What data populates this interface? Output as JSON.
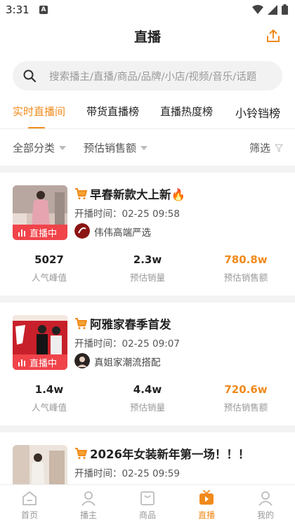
{
  "status_bar": {
    "time": "3:31",
    "notification_icon": "A"
  },
  "header": {
    "title": "直播",
    "share_icon": "share-icon"
  },
  "search": {
    "placeholder": "搜索播主/直播/商品/品牌/小店/视频/音乐/话题"
  },
  "tabs": [
    {
      "label": "实时直播间",
      "active": true
    },
    {
      "label": "带货直播榜",
      "active": false
    },
    {
      "label": "直播热度榜",
      "active": false
    },
    {
      "label": "小铃铛榜",
      "active": false
    }
  ],
  "filters": {
    "category": "全部分类",
    "sort": "预估销售额",
    "filter": "筛选"
  },
  "colors": {
    "accent": "#f08a1c",
    "live_badge": "#f0434a"
  },
  "streams": [
    {
      "title": "早春新款大上新🔥",
      "start_time": "开播时间：02-25 09:58",
      "anchor": "伟伟高端严选",
      "live_label": "直播中",
      "stats": [
        {
          "value": "5027",
          "label": "人气峰值"
        },
        {
          "value": "2.3w",
          "label": "预估销量"
        },
        {
          "value": "780.8w",
          "label": "预估销售额"
        }
      ]
    },
    {
      "title": "阿雅家春季首发",
      "start_time": "开播时间：02-25 09:07",
      "anchor": "真姐家潮流搭配",
      "live_label": "直播中",
      "stats": [
        {
          "value": "1.4w",
          "label": "人气峰值"
        },
        {
          "value": "4.4w",
          "label": "预估销量"
        },
        {
          "value": "720.6w",
          "label": "预估销售额"
        }
      ]
    },
    {
      "title": "2026年女装新年第一场！！！",
      "start_time": "开播时间：02-25 09:59",
      "anchor": "",
      "live_label": "",
      "stats": []
    }
  ],
  "bottom_nav": [
    {
      "label": "首页",
      "icon": "home-icon",
      "active": false
    },
    {
      "label": "播主",
      "icon": "user-icon",
      "active": false
    },
    {
      "label": "商品",
      "icon": "bag-icon",
      "active": false
    },
    {
      "label": "直播",
      "icon": "tv-icon",
      "active": true
    },
    {
      "label": "我的",
      "icon": "profile-icon",
      "active": false
    }
  ]
}
